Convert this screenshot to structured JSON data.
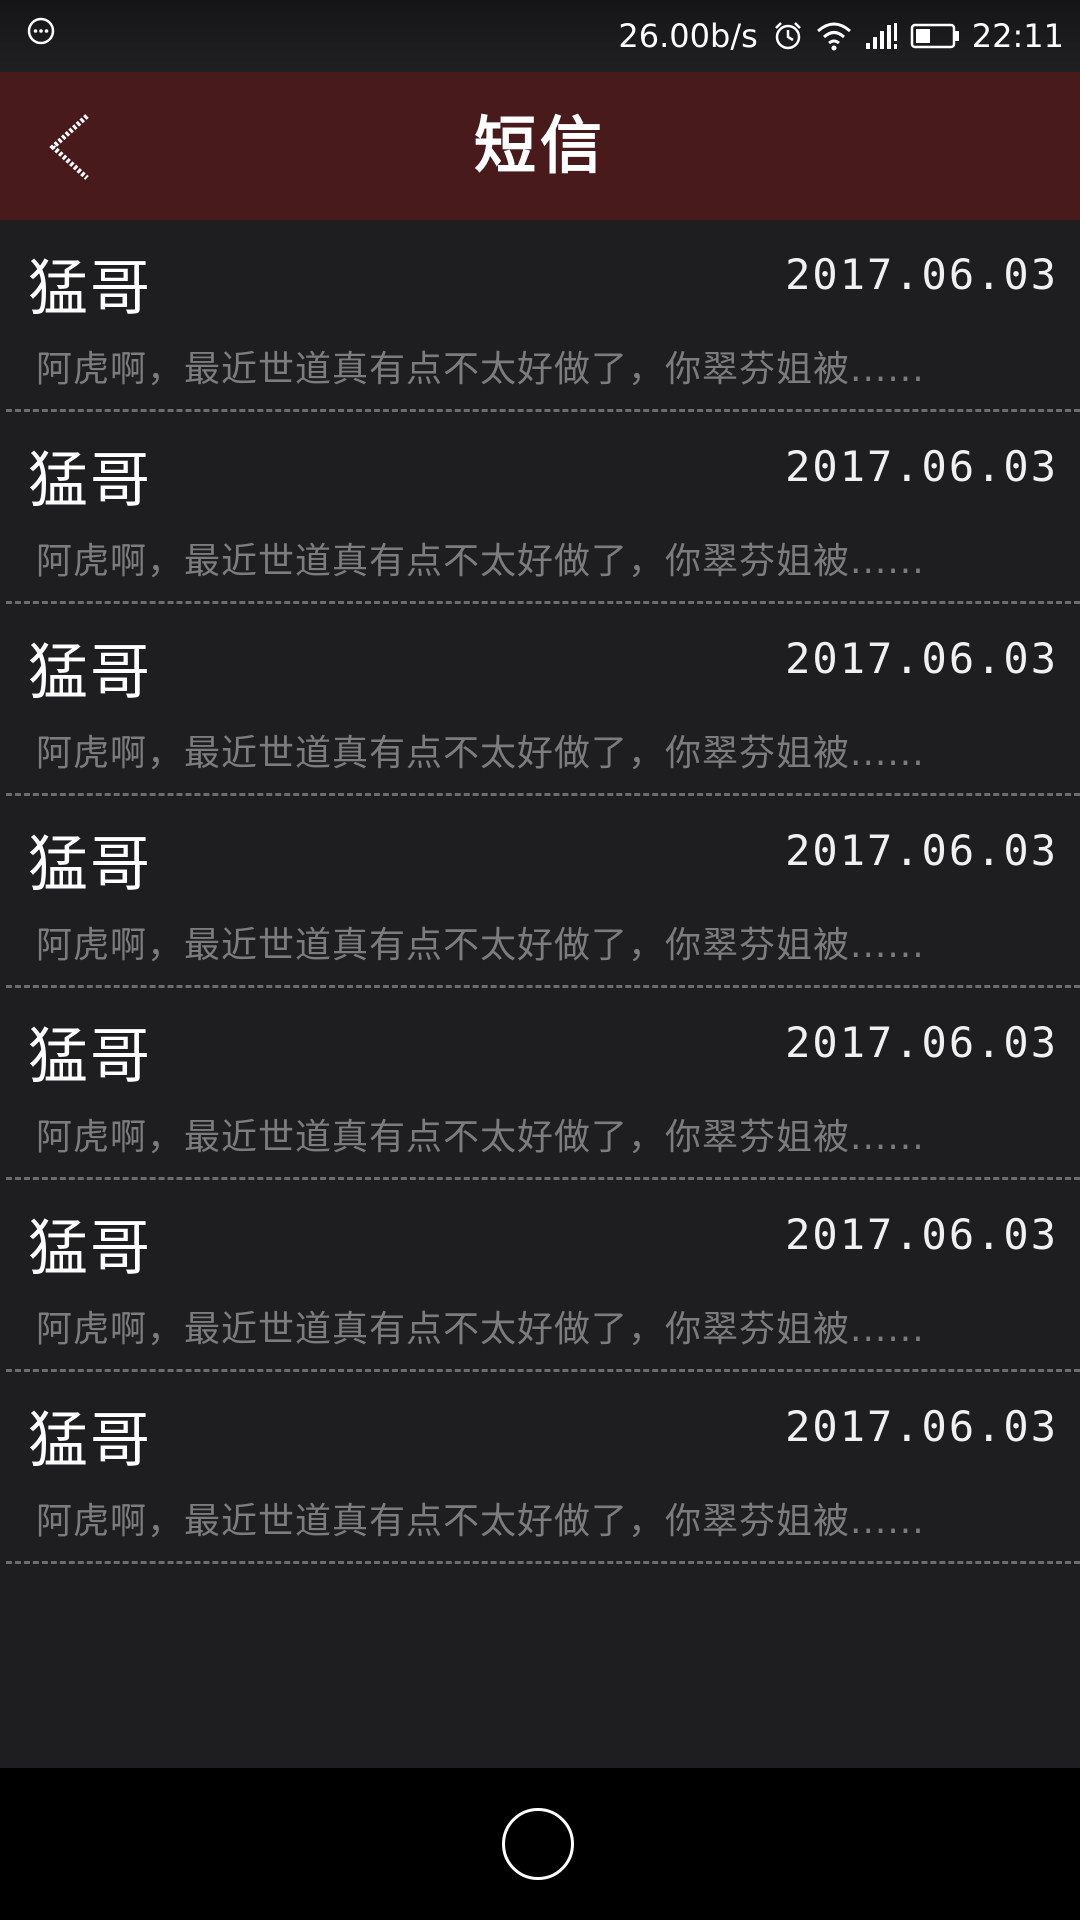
{
  "status_bar": {
    "net_speed": "26.00b/s",
    "time": "22:11",
    "icons": [
      "menu-dots-icon",
      "alarm-icon",
      "wifi-icon",
      "signal-icon",
      "battery-icon"
    ]
  },
  "header": {
    "title": "短信",
    "back_icon": "chevron-left-icon",
    "background_color": "#491a1c"
  },
  "messages": [
    {
      "sender": "猛哥",
      "date": "2017.06.03",
      "preview": "阿虎啊，最近世道真有点不太好做了，你翠芬姐被......"
    },
    {
      "sender": "猛哥",
      "date": "2017.06.03",
      "preview": "阿虎啊，最近世道真有点不太好做了，你翠芬姐被......"
    },
    {
      "sender": "猛哥",
      "date": "2017.06.03",
      "preview": "阿虎啊，最近世道真有点不太好做了，你翠芬姐被......"
    },
    {
      "sender": "猛哥",
      "date": "2017.06.03",
      "preview": "阿虎啊，最近世道真有点不太好做了，你翠芬姐被......"
    },
    {
      "sender": "猛哥",
      "date": "2017.06.03",
      "preview": "阿虎啊，最近世道真有点不太好做了，你翠芬姐被......"
    },
    {
      "sender": "猛哥",
      "date": "2017.06.03",
      "preview": "阿虎啊，最近世道真有点不太好做了，你翠芬姐被......"
    },
    {
      "sender": "猛哥",
      "date": "2017.06.03",
      "preview": "阿虎啊，最近世道真有点不太好做了，你翠芬姐被......"
    }
  ],
  "nav_bar": {
    "home_icon": "home-circle-icon"
  }
}
